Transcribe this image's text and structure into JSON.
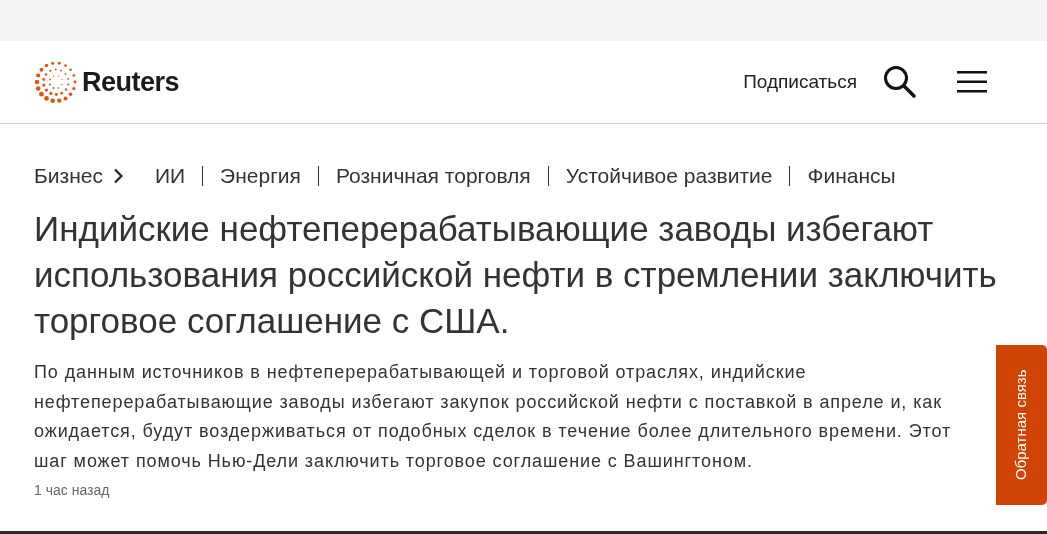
{
  "header": {
    "logo_text": "Reuters",
    "subscribe": "Подписаться"
  },
  "breadcrumbs": [
    {
      "label": "Бизнес",
      "kind": "parent"
    },
    {
      "label": "ИИ",
      "kind": "link"
    },
    {
      "label": "Энергия",
      "kind": "link"
    },
    {
      "label": "Розничная торговля",
      "kind": "link"
    },
    {
      "label": "Устойчивое развитие",
      "kind": "link"
    },
    {
      "label": "Финансы",
      "kind": "link"
    }
  ],
  "article": {
    "headline": "Индийские нефтеперерабатывающие заводы избегают использования российской нефти в стремлении заключить торговое соглашение с США.",
    "summary": "По данным источников в нефтеперерабатывающей и торговой отраслях, индийские нефтеперерабатывающие заводы избегают закупок российской нефти с поставкой в апреле и, как ожидается, будут воздерживаться от подобных сделок в течение более длительного времени. Этот шаг может помочь Нью-Дели заключить торговое соглашение с Вашингтоном.",
    "time": "1 час назад"
  },
  "feedback_tab": "Обратная связь"
}
